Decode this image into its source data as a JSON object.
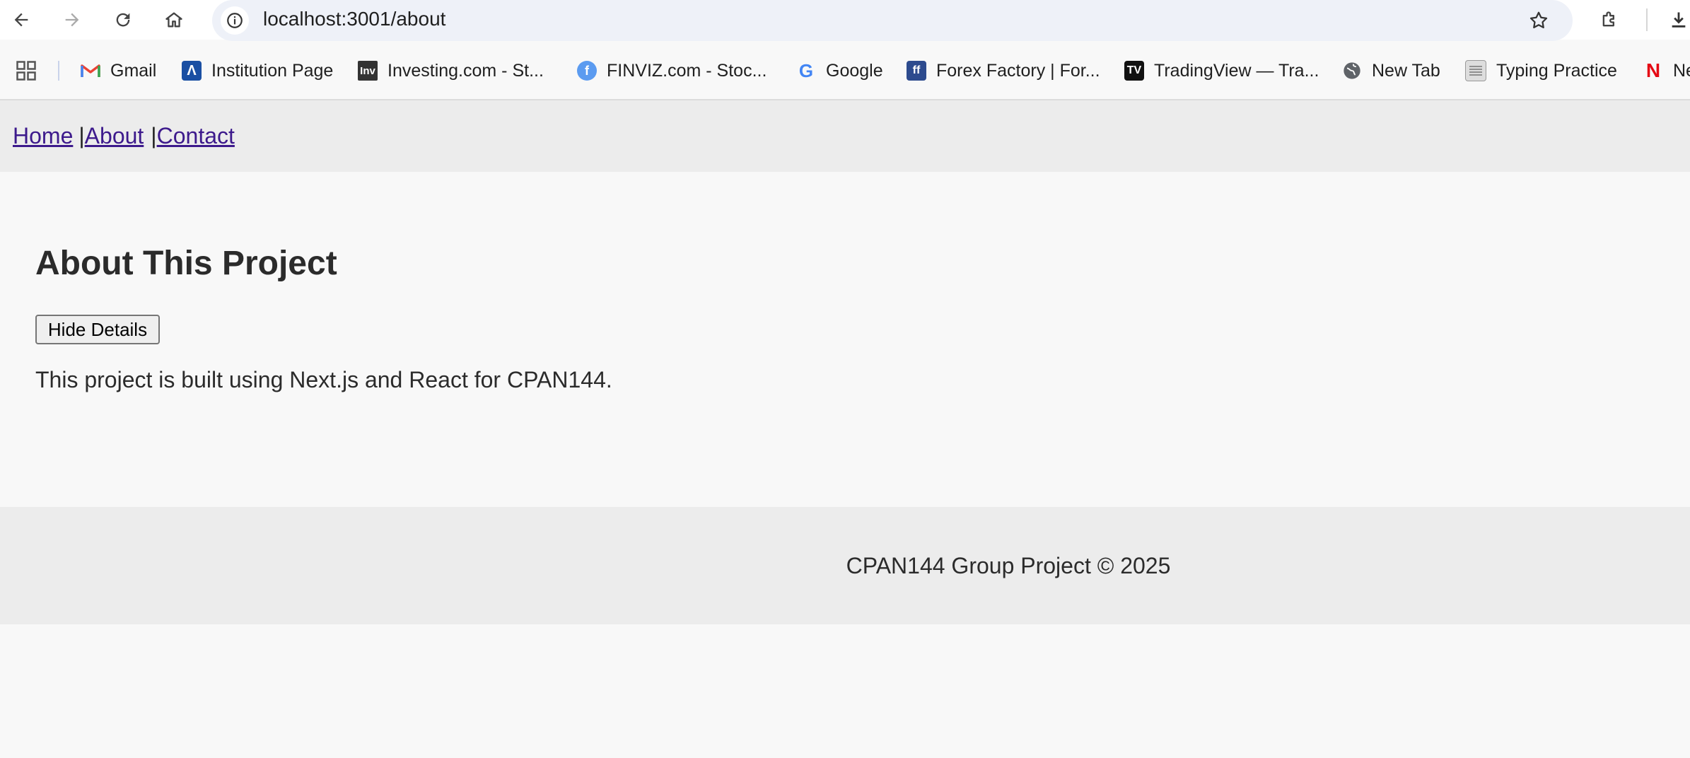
{
  "browser": {
    "url": "localhost:3001/about",
    "bookmarks": [
      {
        "label": "Gmail",
        "icon": "gmail-icon"
      },
      {
        "label": "Institution Page",
        "icon": "institution-icon"
      },
      {
        "label": "Investing.com - St...",
        "icon": "investing-icon"
      },
      {
        "label": "FINVIZ.com - Stoc...",
        "icon": "finviz-icon"
      },
      {
        "label": "Google",
        "icon": "google-icon"
      },
      {
        "label": "Forex Factory | For...",
        "icon": "forex-factory-icon"
      },
      {
        "label": "TradingView — Tra...",
        "icon": "tradingview-icon"
      },
      {
        "label": "New Tab",
        "icon": "globe-icon"
      },
      {
        "label": "Typing Practice",
        "icon": "typing-icon"
      },
      {
        "label": "Ne",
        "icon": "netflix-icon"
      }
    ],
    "accent": "#1a73e8"
  },
  "nav": {
    "links": [
      "Home",
      "About",
      "Contact"
    ],
    "separator": "|"
  },
  "main": {
    "title": "About This Project",
    "toggle_label": "Hide Details",
    "description": "This project is built using Next.js and React for CPAN144."
  },
  "footer": {
    "text": "CPAN144 Group Project © 2025"
  }
}
